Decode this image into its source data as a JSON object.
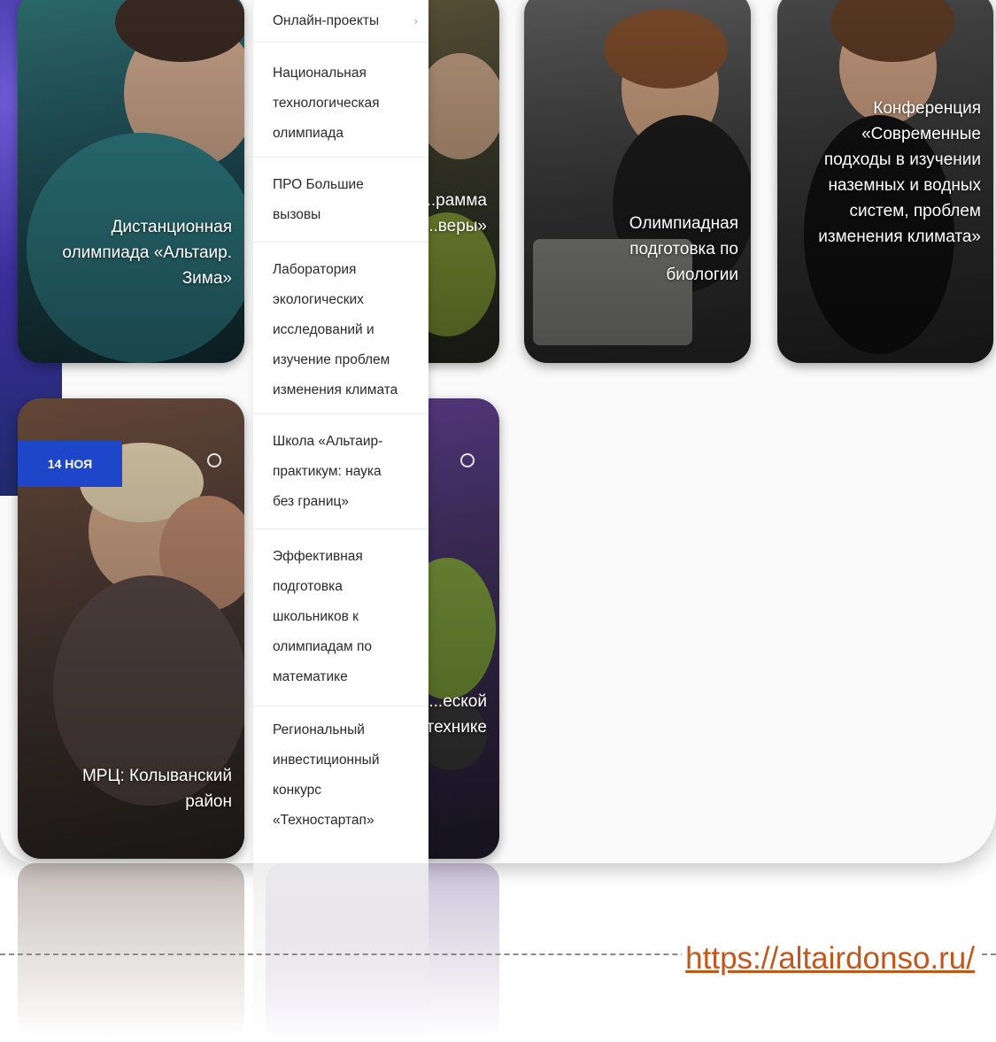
{
  "menu": {
    "items": [
      {
        "label": "Онлайн-проекты",
        "has_submenu": true
      },
      {
        "label": "Национальная технологическая олимпиада"
      },
      {
        "label": "ПРО Большие вызовы"
      },
      {
        "label": "Лаборатория экологических исследований и изучение проблем изменения климата"
      },
      {
        "label": "Школа «Альтаир-практикум: наука без границ»"
      },
      {
        "label": "Эффективная подготовка школьников к олимпиадам по математике"
      },
      {
        "label": "Региональный инвестиционный конкурс «Технoстартап»"
      }
    ]
  },
  "cards": [
    {
      "title": "Дистанционная олимпиада «Альтаир. Зима»"
    },
    {
      "title": "...льная ...еская ...рамма «...веры»"
    },
    {
      "title": "Олимпиадная подготовка по биологии"
    },
    {
      "title": "Конференция «Современные подходы в изучении наземных и водных систем, проблем изменения климата»"
    },
    {
      "title": "МРЦ: Колыванский район",
      "date_badge": "14 НОЯ"
    },
    {
      "title": "...льный ...нат по ...еской ...технике"
    }
  ],
  "icons": [
    "clock-icon",
    "chevron-right-icon"
  ],
  "link": {
    "url": "https://altairdonso.ru/"
  },
  "colors": {
    "badge": "#1e46c8",
    "link": "#c0571d"
  }
}
